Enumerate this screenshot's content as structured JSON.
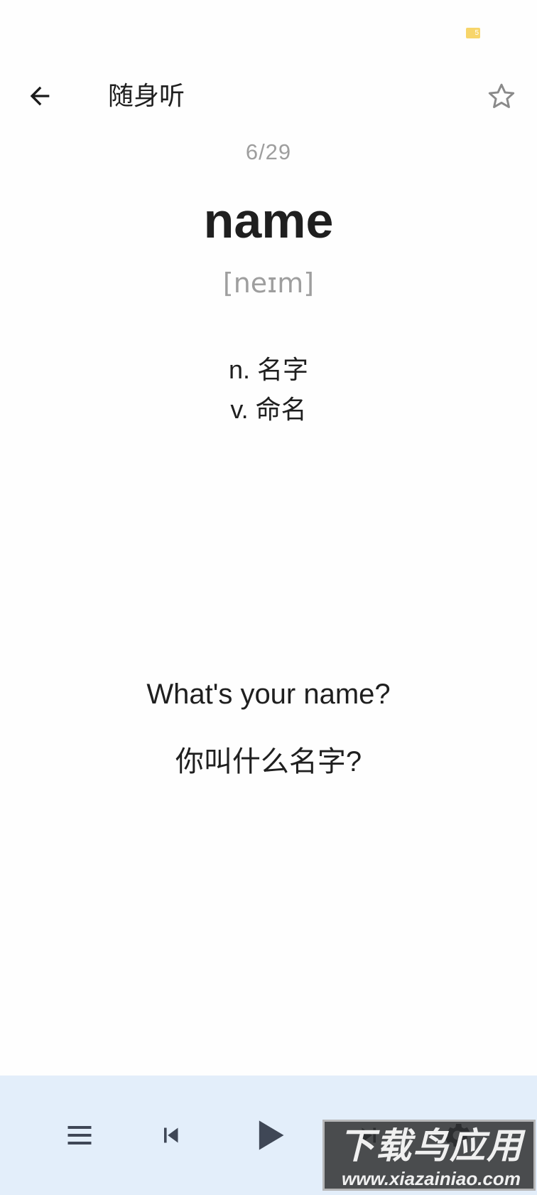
{
  "status_bar": {
    "battery_label": "5"
  },
  "app_bar": {
    "title": "随身听",
    "back_icon": "arrow-left-icon",
    "favorite_icon": "star-outline-icon"
  },
  "card": {
    "counter": "6/29",
    "word": "name",
    "phonetic": "[neɪm]",
    "definitions": [
      "n. 名字",
      "v. 命名"
    ],
    "example_en": "What's your name?",
    "example_zh": "你叫什么名字?"
  },
  "player": {
    "buttons": [
      {
        "name": "playlist-menu",
        "icon": "menu-icon"
      },
      {
        "name": "previous",
        "icon": "skip-previous-icon"
      },
      {
        "name": "play",
        "icon": "play-icon"
      },
      {
        "name": "next",
        "icon": "skip-next-icon"
      },
      {
        "name": "settings",
        "icon": "gear-icon"
      }
    ],
    "background": "#e3eefa"
  },
  "watermark": {
    "title": "下载鸟应用",
    "url": "www.xiazainiao.com"
  },
  "colors": {
    "text_primary": "#1f1f1f",
    "text_secondary": "#9e9e9e",
    "battery": "#f7d56a"
  }
}
